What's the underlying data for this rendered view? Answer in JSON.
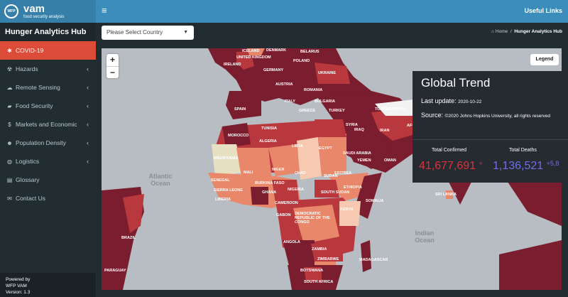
{
  "header": {
    "logo_seal": "WFP",
    "logo_text": "vam",
    "logo_sub": "food security analysis",
    "useful_links": "Useful Links"
  },
  "sidebar": {
    "title": "Hunger Analytics Hub",
    "items": [
      {
        "label": "COVID-19",
        "icon": "virus-icon",
        "glyph": "✱"
      },
      {
        "label": "Hazards",
        "icon": "hazard-icon",
        "glyph": "☢"
      },
      {
        "label": "Remote Sensing",
        "icon": "cloud-icon",
        "glyph": "☁"
      },
      {
        "label": "Food Security",
        "icon": "truck-icon",
        "glyph": "▰"
      },
      {
        "label": "Markets and Economic",
        "icon": "dollar-icon",
        "glyph": "$"
      },
      {
        "label": "Population Density",
        "icon": "users-icon",
        "glyph": "☻"
      },
      {
        "label": "Logistics",
        "icon": "globe-icon",
        "glyph": "◍"
      },
      {
        "label": "Glossary",
        "icon": "book-icon",
        "glyph": "▤"
      },
      {
        "label": "Contact Us",
        "icon": "envelope-icon",
        "glyph": "✉"
      }
    ],
    "footer": [
      "Powered by",
      "WFP VAM",
      "Version: 1.3"
    ]
  },
  "toolbar": {
    "country_placeholder": "Please Select Country",
    "breadcrumb_home": "Home",
    "breadcrumb_separator": "/",
    "breadcrumb_current": "Hunger Analytics Hub"
  },
  "map": {
    "zoom_in": "+",
    "zoom_out": "−",
    "legend": "Legend",
    "oceans": [
      {
        "name": "Atlantic Ocean"
      },
      {
        "name": "Indian Ocean"
      }
    ],
    "countries": [
      "ICELAND",
      "UNITED KINGDOM",
      "IRELAND",
      "DENMARK",
      "BELARUS",
      "POLAND",
      "GERMANY",
      "UKRAINE",
      "AUSTRIA",
      "ROMANIA",
      "ITALY",
      "BULGARIA",
      "GREECE",
      "TURKEY",
      "SPAIN",
      "SYRIA",
      "IRAQ",
      "IRAN",
      "TURKMENISTAN",
      "AFGHANISTAN",
      "MOROCCO",
      "TUNISIA",
      "ALGERIA",
      "LIBYA",
      "EGYPT",
      "SAUDI ARABIA",
      "YEMEN",
      "OMAN",
      "MAURITANIA",
      "MALI",
      "NIGER",
      "CHAD",
      "SUDAN",
      "ERITREA",
      "SENEGAL",
      "BURKINA FASO",
      "NIGERIA",
      "ETHIOPIA",
      "SOUTH SUDAN",
      "SIERRA LEONE",
      "LIBERIA",
      "GHANA",
      "CAMEROON",
      "SOMALIA",
      "GABON",
      "DEMOCRATIC REPUBLIC OF THE CONGO",
      "KENYA",
      "ANGOLA",
      "ZAMBIA",
      "ZIMBABWE",
      "MADAGASCAR",
      "BOTSWANA",
      "SOUTH AFRICA",
      "BRAZIL",
      "PARAGUAY",
      "SRI LANKA"
    ],
    "colors": {
      "ocean": "#b8bdc3",
      "dark": "#7a1d2e",
      "mid": "#b8383e",
      "light": "#e8876a",
      "pale": "#f6c9b0",
      "nodata": "#e8e0c2"
    }
  },
  "trend": {
    "title": "Global Trend",
    "update_label": "Last update:",
    "update_value": "2020-10-22",
    "source_label": "Source:",
    "source_value": "©2020 Johns Hopkins University, all rights reserved",
    "confirmed_label": "Total Confirmed",
    "confirmed_value": "41,677,691",
    "confirmed_extra": "+",
    "deaths_label": "Total Deaths",
    "deaths_value": "1,136,521",
    "deaths_extra": "+5,8",
    "colors": {
      "confirmed": "#e0303a",
      "deaths": "#6e6ee6"
    }
  }
}
